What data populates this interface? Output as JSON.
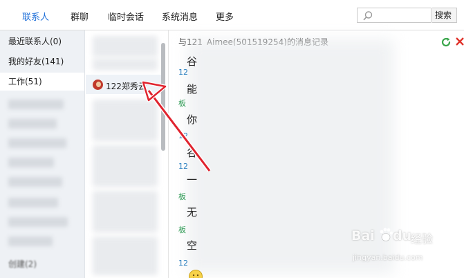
{
  "nav": {
    "tabs": [
      {
        "label": "联系人",
        "active": true
      },
      {
        "label": "群聊",
        "active": false
      },
      {
        "label": "临时会话",
        "active": false
      },
      {
        "label": "系统消息",
        "active": false
      },
      {
        "label": "更多",
        "active": false
      }
    ],
    "search_icon": "search-icon",
    "search_placeholder": "",
    "search_button": "搜索"
  },
  "groups": {
    "items": [
      {
        "label": "最近联系人(0)",
        "active": false
      },
      {
        "label": "我的好友(141)",
        "active": false
      },
      {
        "label": "工作(51)",
        "active": true
      }
    ],
    "bottom_label": "创建(2)"
  },
  "contacts": {
    "selected": {
      "name": "122郑秀云",
      "avatar_icon": "avatar-icon"
    }
  },
  "history": {
    "title": "与121_Aimee(501519254)的消息记录",
    "refresh_icon": "refresh-icon",
    "close_icon": "close-icon",
    "messages": [
      {
        "name": "",
        "text": "谷"
      },
      {
        "name": "12",
        "text": "能"
      },
      {
        "name": "板",
        "text": "你"
      },
      {
        "name": "12",
        "text": "谷"
      },
      {
        "name": "12",
        "text": "一"
      },
      {
        "name": "板",
        "text": "无"
      },
      {
        "name": "板",
        "text": "空"
      },
      {
        "name": "12",
        "text": ""
      }
    ],
    "emoji_icon": "smiley-icon"
  },
  "annotation": {
    "icon": "red-arrow-icon",
    "color": "#e0232e"
  },
  "watermark": {
    "brand": "Bai",
    "brand2": "du",
    "suffix": "经验",
    "url": "jingyan.baidu.com"
  },
  "colors": {
    "accent": "#1e6fd9",
    "panel_bg": "#eef1f5",
    "link_blue": "#2a7fbf",
    "link_green": "#2e9a54"
  }
}
